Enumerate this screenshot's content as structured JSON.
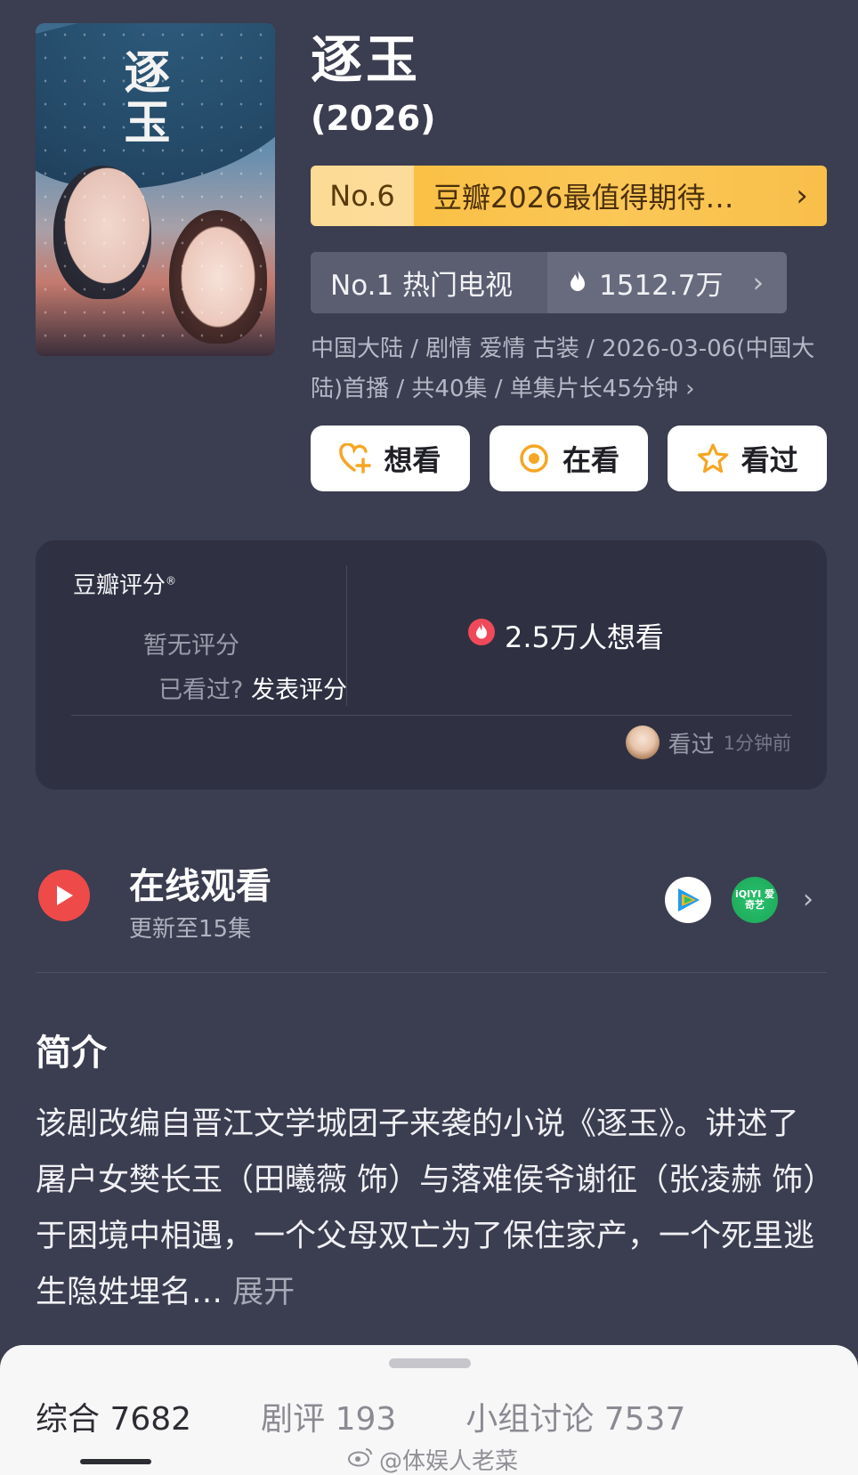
{
  "header": {
    "title": "逐玉",
    "year": "(2026)",
    "poster_title_art": "逐玉"
  },
  "rank": {
    "number": "No.6",
    "list_name": "豆瓣2026最值得期待…",
    "chevron": "›"
  },
  "hot": {
    "label": "No.1 热门电视",
    "value": "1512.7万",
    "icon": "flame-icon"
  },
  "meta_text": "中国大陆 / 剧情 爱情 古装 / 2026-03-06(中国大陆)首播 / 共40集 / 单集片长45分钟 ›",
  "actions": [
    {
      "label": "想看",
      "icon": "heart-plus-icon"
    },
    {
      "label": "在看",
      "icon": "target-icon"
    },
    {
      "label": "看过",
      "icon": "star-icon"
    }
  ],
  "rating": {
    "label": "豆瓣评分",
    "registered": "®",
    "no_score": "暂无评分",
    "prompt_prefix": "已看过?",
    "prompt_action": "发表评分",
    "want_count": "2.5万人想看",
    "recent_status": "看过",
    "recent_time": "1分钟前"
  },
  "watch": {
    "title": "在线观看",
    "subtitle": "更新至15集",
    "platforms": [
      "tencent-video-icon",
      "iqiyi-icon"
    ],
    "iqiyi_text": "iQIYI 爱奇艺"
  },
  "synopsis": {
    "title": "简介",
    "body": "该剧改编自晋江文学城团子来袭的小说《逐玉》。讲述了屠户女樊长玉（田曦薇 饰）与落难侯爷谢征（张凌赫 饰）于困境中相遇，一个父母双亡为了保住家产，一个死里逃生隐姓埋名…",
    "expand": "展开"
  },
  "tabs": [
    {
      "label": "综合",
      "count": "7682"
    },
    {
      "label": "剧评",
      "count": "193"
    },
    {
      "label": "小组讨论",
      "count": "7537"
    }
  ],
  "watermark": "@体娱人老菜",
  "colors": {
    "background": "#3b3d50",
    "rank_bar": "#f9bd3e",
    "play_red": "#ee4a4a",
    "iqiyi_green": "#1aa85a"
  }
}
